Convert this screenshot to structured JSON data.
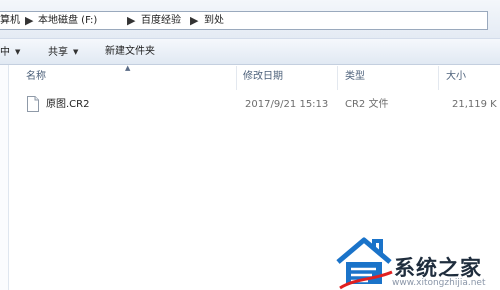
{
  "breadcrumb": {
    "items": [
      "算机",
      "本地磁盘 (F:)",
      "百度经验",
      "到处"
    ],
    "separator": "▶"
  },
  "toolbar": {
    "items": [
      {
        "label": "中",
        "has_dropdown": true
      },
      {
        "label": "共享",
        "has_dropdown": true
      },
      {
        "label": "新建文件夹",
        "has_dropdown": false
      }
    ]
  },
  "columns": {
    "name": "名称",
    "modified": "修改日期",
    "type": "类型",
    "size": "大小"
  },
  "files": [
    {
      "name": "原图.CR2",
      "modified": "2017/9/21 15:13",
      "type": "CR2 文件",
      "size": "21,119 K"
    }
  ],
  "watermark": {
    "title": "系统之家",
    "url": "www.xitongzhijia.net"
  },
  "colors": {
    "toolbar_bg": "#e4ebf4",
    "header_text": "#4c607a",
    "meta_text": "#6d6d6d",
    "watermark_blue": "#1a73c9",
    "watermark_red": "#e02020"
  }
}
